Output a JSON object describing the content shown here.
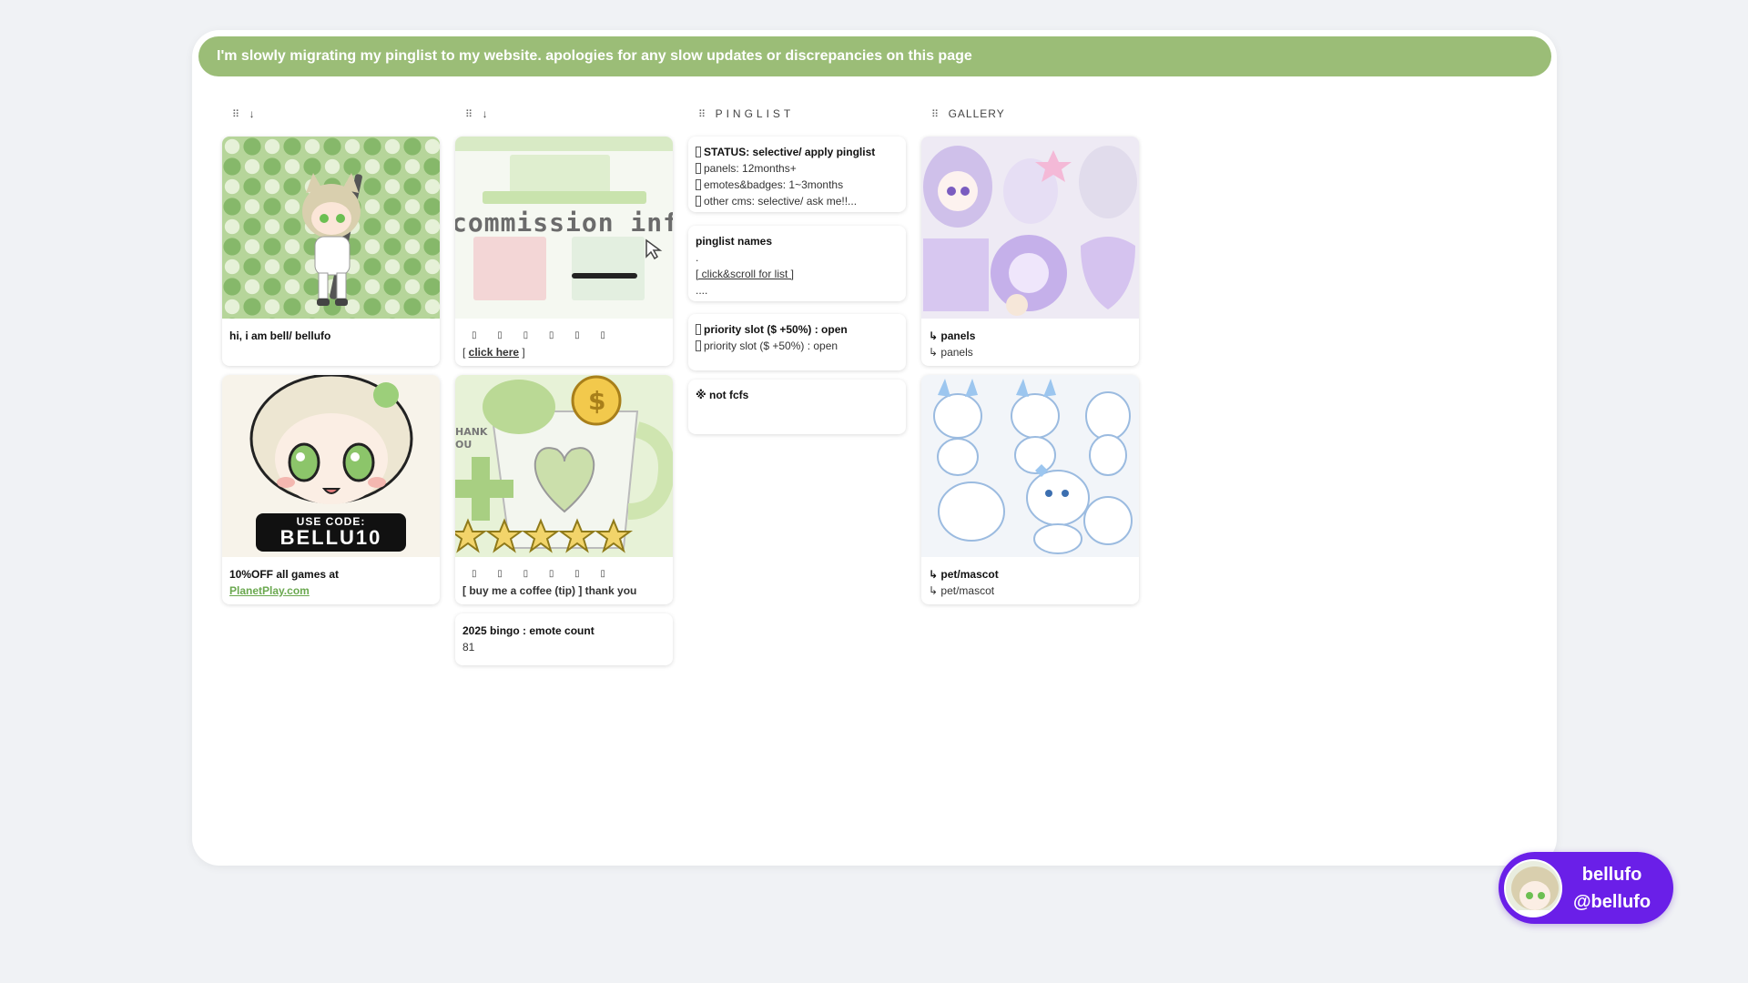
{
  "banner": {
    "text": "I'm slowly migrating my pinglist to my website. apologies for any slow updates or discrepancies on this page"
  },
  "columns": [
    {
      "grip": "⠿",
      "arrow": "↓",
      "title": ""
    },
    {
      "grip": "⠿",
      "arrow": "↓",
      "title": ""
    },
    {
      "grip": "⠿",
      "arrow": "",
      "title": "PINGLIST"
    },
    {
      "grip": "⠿",
      "arrow": "",
      "title": "GALLERY"
    }
  ],
  "col1": {
    "intro": {
      "title": "hi, i am bell/ bellufo"
    },
    "promo": {
      "code_label": "USE CODE:",
      "code_value": "BELLU10",
      "title": "10%OFF all games at",
      "link": "PlanetPlay.com"
    }
  },
  "col2": {
    "commission": {
      "image_text": "commission info",
      "dots": "▯ ▯ ▯ ▯ ▯ ▯",
      "link_open": "[ ",
      "link": "click here",
      "link_close": " ]"
    },
    "coffee": {
      "image_text": "THANK YOU",
      "dots": "▯ ▯ ▯ ▯ ▯ ▯",
      "text": "[ buy me a coffee (tip) ] thank you"
    },
    "bingo": {
      "title": "2025 bingo : emote count",
      "value": "81"
    }
  },
  "col3": {
    "status": {
      "title": "STATUS: selective/ apply pinglist",
      "lines": [
        "panels: 12months+",
        "emotes&badges: 1~3months",
        "other cms: selective/ ask me!!..."
      ]
    },
    "names": {
      "title": "pinglist names",
      "line1": ".",
      "link": "[ click&scroll for list ]",
      "line3": "...."
    },
    "priority": {
      "title": "priority slot ($ +50%) : open",
      "line": "priority slot ($ +50%) : open"
    },
    "notfcfs": {
      "title": "※ not fcfs"
    }
  },
  "col4": {
    "panels": {
      "title": "↳ panels",
      "sub": "↳ panels"
    },
    "pet": {
      "title": "↳ pet/mascot",
      "sub": "↳ pet/mascot"
    }
  },
  "profile": {
    "name": "bellufo",
    "handle": "@bellufo"
  },
  "colors": {
    "banner": "#9bbd77",
    "profile_bg": "#6a1fe8",
    "link_green": "#6aa84f",
    "page_bg": "#f0f2f5"
  }
}
